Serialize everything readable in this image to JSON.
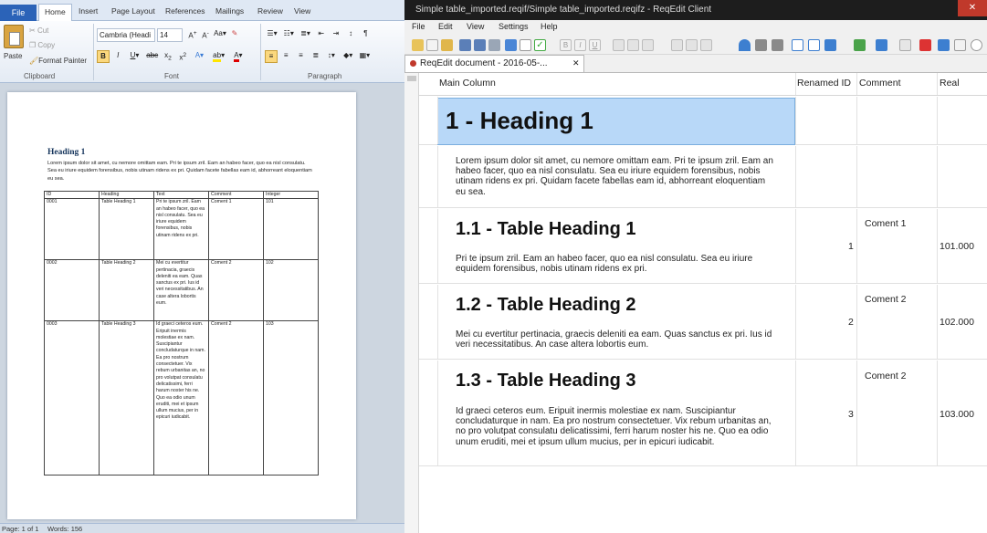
{
  "word": {
    "file_tab": "File",
    "tabs": [
      "Home",
      "Insert",
      "Page Layout",
      "References",
      "Mailings",
      "Review",
      "View"
    ],
    "clipboard": {
      "paste": "Paste",
      "cut": "Cut",
      "copy": "Copy",
      "format_painter": "Format Painter",
      "label": "Clipboard"
    },
    "font": {
      "name": "Cambria (Headi",
      "size": "14",
      "label": "Font"
    },
    "paragraph": {
      "label": "Paragraph"
    },
    "document": {
      "heading": "Heading 1",
      "paragraph": "Lorem ipsum dolor sit amet, cu nemore omittam eam. Pri te ipsum zril. Eam an habeo facer, quo ea nisl consulatu. Sea eu iriure equidem forensibus, nobis utinam ridens ex pri. Quidam facete fabellas eam id, abhorreant eloquentiam eu sea.",
      "table": {
        "headers": [
          "ID",
          "Heading",
          "Text",
          "Comment",
          "Integer"
        ],
        "rows": [
          {
            "id": "0001",
            "heading": "Table Heading 1",
            "text": "Pri te ipsum zril. Eam an habeo facer, quo ea nisl consulatu. Sea eu iriure equidem forensibus, nobis utinam ridens ex pri.",
            "comment": "Coment 1",
            "integer": "101"
          },
          {
            "id": "0002",
            "heading": "Table Heading 2",
            "text": "Mei cu evertitur pertinacia, graecis deleniti ea eam. Quas sanctus ex pri. Ius id veri necessitatibus. An case altera lobortis eum.",
            "comment": "Coment 2",
            "integer": "102"
          },
          {
            "id": "0003",
            "heading": "Table Heading 3",
            "text": "Id graeci ceteros eum. Eripuit inermis molestiae ex nam. Suscipiantur concludaturque in nam. Ea pro nostrum consectetuer. Vix rebum urbanitas an, no pro volutpat consulatu delicatissimi, ferri harum noster his ne. Quo ea odio unum eruditi, mei et ipsum ullum mucius, per in epicuri iudicabit.",
            "comment": "Coment 2",
            "integer": "103"
          }
        ]
      }
    },
    "status": {
      "page": "Page: 1 of 1",
      "words": "Words: 156"
    }
  },
  "reqedit": {
    "title": "Simple table_imported.reqif/Simple table_imported.reqifz - ReqEdit Client",
    "menu": [
      "File",
      "Edit",
      "View",
      "Settings",
      "Help"
    ],
    "doc_tab": "ReqEdit document - 2016-05-...",
    "columns": [
      "Main Column",
      "Renamed ID",
      "Comment",
      "Real"
    ],
    "rows": [
      {
        "heading": "1 - Heading 1",
        "text": "",
        "id": "",
        "comment": "",
        "real": ""
      },
      {
        "heading": "",
        "text": "Lorem ipsum dolor sit amet, cu nemore omittam eam. Pri te ipsum zril. Eam an habeo facer, quo ea nisl consulatu. Sea eu iriure equidem forensibus, nobis utinam ridens ex pri. Quidam facete fabellas eam id, abhorreant eloquentiam eu sea.",
        "id": "",
        "comment": "",
        "real": ""
      },
      {
        "heading": "1.1 - Table Heading 1",
        "text": "Pri te ipsum zril. Eam an habeo facer, quo ea nisl consulatu. Sea eu iriure equidem forensibus, nobis utinam ridens ex pri.",
        "id": "1",
        "comment": "Coment 1",
        "real": "101.000"
      },
      {
        "heading": "1.2 - Table Heading 2",
        "text": "Mei cu evertitur pertinacia, graecis deleniti ea eam. Quas sanctus ex pri. Ius id veri necessitatibus. An case altera lobortis eum.",
        "id": "2",
        "comment": "Coment 2",
        "real": "102.000"
      },
      {
        "heading": "1.3 - Table Heading 3",
        "text": "Id graeci ceteros eum. Eripuit inermis molestiae ex nam. Suscipiantur concludaturque in nam. Ea pro nostrum consectetuer. Vix rebum urbanitas an, no pro volutpat consulatu delicatissimi, ferri harum noster his ne. Quo ea odio unum eruditi, mei et ipsum ullum mucius, per in epicuri iudicabit.",
        "id": "3",
        "comment": "Coment 2",
        "real": "103.000"
      }
    ]
  },
  "colors": {
    "word_accent": "#2b63b8",
    "selected_cell": "#b8d8f8",
    "selected_border": "#7aaede",
    "title_bar": "#1d1d1d",
    "close": "#c0392b"
  },
  "icons": {
    "word": [
      "paste-icon",
      "scissors-icon",
      "copy-icon",
      "format-painter-icon",
      "bold-icon",
      "italic-icon",
      "underline-icon",
      "strikethrough-icon",
      "subscript-icon",
      "superscript-icon",
      "text-effects-icon",
      "highlight-icon",
      "font-color-icon",
      "bullets-icon",
      "numbering-icon",
      "multilevel-list-icon",
      "decrease-indent-icon",
      "increase-indent-icon",
      "sort-icon",
      "pilcrow-icon",
      "align-left-icon",
      "align-center-icon",
      "align-right-icon",
      "justify-icon",
      "line-spacing-icon",
      "shading-icon",
      "borders-icon",
      "grow-font-icon",
      "shrink-font-icon",
      "change-case-icon",
      "clear-formatting-icon"
    ],
    "reqedit": [
      "new-icon",
      "open-icon",
      "save-icon",
      "save-all-icon",
      "edit-icon",
      "attribute-icon",
      "checkbox-icon",
      "bold-icon",
      "italic-icon",
      "underline-icon",
      "filter-icon",
      "columns-icon",
      "view-icon",
      "link-icon",
      "close-tab-icon"
    ]
  }
}
